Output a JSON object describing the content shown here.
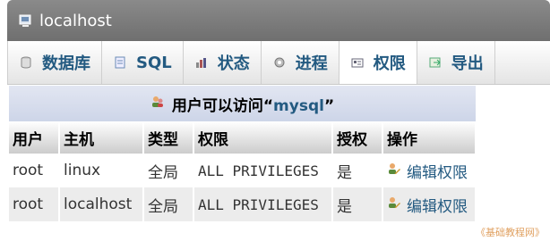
{
  "window": {
    "title": "localhost"
  },
  "tabs": [
    {
      "label": "数据库",
      "icon": "database-icon",
      "active": false
    },
    {
      "label": "SQL",
      "icon": "sql-icon",
      "active": false
    },
    {
      "label": "状态",
      "icon": "status-icon",
      "active": false
    },
    {
      "label": "进程",
      "icon": "gear-icon",
      "active": false
    },
    {
      "label": "权限",
      "icon": "privileges-icon",
      "active": true
    },
    {
      "label": "导出",
      "icon": "export-icon",
      "active": false
    }
  ],
  "table": {
    "caption_prefix": "用户可以访问“",
    "caption_db": "mysql",
    "caption_suffix": "”",
    "headers": [
      "用户",
      "主机",
      "类型",
      "权限",
      "授权",
      "操作"
    ],
    "rows": [
      {
        "user": "root",
        "host": "linux",
        "type": "全局",
        "privileges": "ALL PRIVILEGES",
        "grant": "是",
        "action": "编辑权限"
      },
      {
        "user": "root",
        "host": "localhost",
        "type": "全局",
        "privileges": "ALL PRIVILEGES",
        "grant": "是",
        "action": "编辑权限"
      }
    ]
  },
  "watermark": "《基础教程网》",
  "colors": {
    "link": "#235a81",
    "titlebar": "#7a7a7a",
    "caption_bg": "#d5dcec"
  }
}
